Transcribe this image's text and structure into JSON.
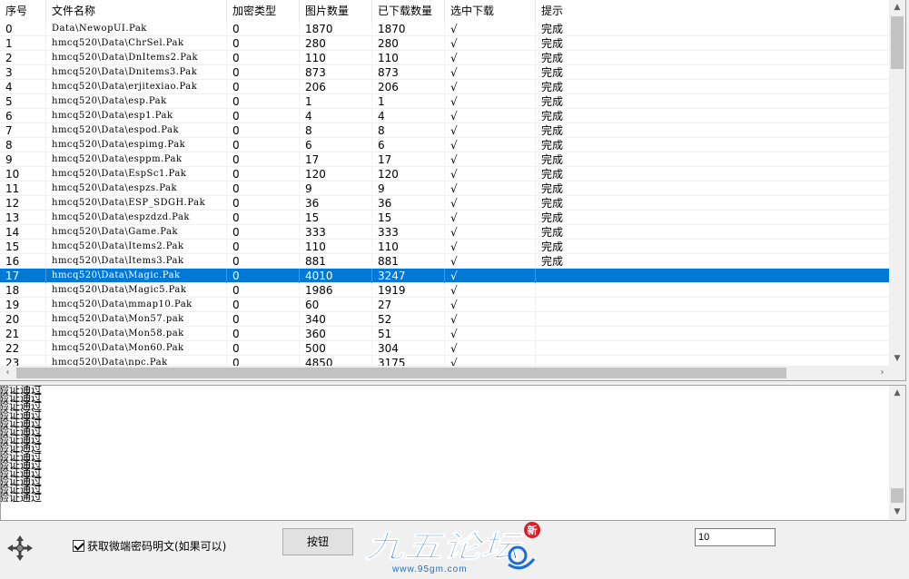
{
  "table": {
    "headers": [
      "序号",
      "文件名称",
      "加密类型",
      "图片数量",
      "已下载数量",
      "选中下载",
      "提示"
    ],
    "selected_index": 17,
    "rows": [
      {
        "idx": "0",
        "name": "Data\\NewopUI.Pak",
        "enc": "0",
        "imgs": "1870",
        "dl": "1870",
        "check": "√",
        "tip": "完成"
      },
      {
        "idx": "1",
        "name": "hmcq520\\Data\\ChrSel.Pak",
        "enc": "0",
        "imgs": "280",
        "dl": "280",
        "check": "√",
        "tip": "完成"
      },
      {
        "idx": "2",
        "name": "hmcq520\\Data\\DnItems2.Pak",
        "enc": "0",
        "imgs": "110",
        "dl": "110",
        "check": "√",
        "tip": "完成"
      },
      {
        "idx": "3",
        "name": "hmcq520\\Data\\Dnitems3.Pak",
        "enc": "0",
        "imgs": "873",
        "dl": "873",
        "check": "√",
        "tip": "完成"
      },
      {
        "idx": "4",
        "name": "hmcq520\\Data\\erjitexiao.Pak",
        "enc": "0",
        "imgs": "206",
        "dl": "206",
        "check": "√",
        "tip": "完成"
      },
      {
        "idx": "5",
        "name": "hmcq520\\Data\\esp.Pak",
        "enc": "0",
        "imgs": "1",
        "dl": "1",
        "check": "√",
        "tip": "完成"
      },
      {
        "idx": "6",
        "name": "hmcq520\\Data\\esp1.Pak",
        "enc": "0",
        "imgs": "4",
        "dl": "4",
        "check": "√",
        "tip": "完成"
      },
      {
        "idx": "7",
        "name": "hmcq520\\Data\\espod.Pak",
        "enc": "0",
        "imgs": "8",
        "dl": "8",
        "check": "√",
        "tip": "完成"
      },
      {
        "idx": "8",
        "name": "hmcq520\\Data\\espimg.Pak",
        "enc": "0",
        "imgs": "6",
        "dl": "6",
        "check": "√",
        "tip": "完成"
      },
      {
        "idx": "9",
        "name": "hmcq520\\Data\\esppm.Pak",
        "enc": "0",
        "imgs": "17",
        "dl": "17",
        "check": "√",
        "tip": "完成"
      },
      {
        "idx": "10",
        "name": "hmcq520\\Data\\EspSc1.Pak",
        "enc": "0",
        "imgs": "120",
        "dl": "120",
        "check": "√",
        "tip": "完成"
      },
      {
        "idx": "11",
        "name": "hmcq520\\Data\\espzs.Pak",
        "enc": "0",
        "imgs": "9",
        "dl": "9",
        "check": "√",
        "tip": "完成"
      },
      {
        "idx": "12",
        "name": "hmcq520\\Data\\ESP_SDGH.Pak",
        "enc": "0",
        "imgs": "36",
        "dl": "36",
        "check": "√",
        "tip": "完成"
      },
      {
        "idx": "13",
        "name": "hmcq520\\Data\\espzdzd.Pak",
        "enc": "0",
        "imgs": "15",
        "dl": "15",
        "check": "√",
        "tip": "完成"
      },
      {
        "idx": "14",
        "name": "hmcq520\\Data\\Game.Pak",
        "enc": "0",
        "imgs": "333",
        "dl": "333",
        "check": "√",
        "tip": "完成"
      },
      {
        "idx": "15",
        "name": "hmcq520\\Data\\Items2.Pak",
        "enc": "0",
        "imgs": "110",
        "dl": "110",
        "check": "√",
        "tip": "完成"
      },
      {
        "idx": "16",
        "name": "hmcq520\\Data\\Items3.Pak",
        "enc": "0",
        "imgs": "881",
        "dl": "881",
        "check": "√",
        "tip": "完成"
      },
      {
        "idx": "17",
        "name": "hmcq520\\Data\\Magic.Pak",
        "enc": "0",
        "imgs": "4010",
        "dl": "3247",
        "check": "√",
        "tip": ""
      },
      {
        "idx": "18",
        "name": "hmcq520\\Data\\Magic5.Pak",
        "enc": "0",
        "imgs": "1986",
        "dl": "1919",
        "check": "√",
        "tip": ""
      },
      {
        "idx": "19",
        "name": "hmcq520\\Data\\mmap10.Pak",
        "enc": "0",
        "imgs": "60",
        "dl": "27",
        "check": "√",
        "tip": ""
      },
      {
        "idx": "20",
        "name": "hmcq520\\Data\\Mon57.pak",
        "enc": "0",
        "imgs": "340",
        "dl": "52",
        "check": "√",
        "tip": ""
      },
      {
        "idx": "21",
        "name": "hmcq520\\Data\\Mon58.pak",
        "enc": "0",
        "imgs": "360",
        "dl": "51",
        "check": "√",
        "tip": ""
      },
      {
        "idx": "22",
        "name": "hmcq520\\Data\\Mon60.Pak",
        "enc": "0",
        "imgs": "500",
        "dl": "304",
        "check": "√",
        "tip": ""
      },
      {
        "idx": "23",
        "name": "hmcq520\\Data\\npc.Pak",
        "enc": "0",
        "imgs": "4850",
        "dl": "3175",
        "check": "√",
        "tip": ""
      }
    ]
  },
  "log": {
    "lines": [
      "验证通过",
      "验证通过",
      "验证通过",
      "验证通过",
      "验证通过",
      "验证通过",
      "验证通过",
      "验证通过",
      "验证通过",
      "验证通过",
      "验证通过",
      "验证通过",
      "验证通过",
      "验证通过"
    ]
  },
  "controls": {
    "checkbox_label": "获取微端密码明文(如果可以)",
    "checkbox_checked": true,
    "button_label": "按钮",
    "number_value": "10"
  },
  "logo": {
    "text": "九五论坛",
    "url_text": "www.95gm.com",
    "badge": "新"
  },
  "colors": {
    "selection": "#0078d7",
    "logo_blue": "#1a6fd1"
  }
}
